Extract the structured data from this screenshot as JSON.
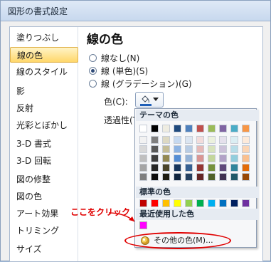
{
  "window": {
    "title": "図形の書式設定"
  },
  "sidebar": {
    "items": [
      {
        "label": "塗りつぶし"
      },
      {
        "label": "線の色"
      },
      {
        "label": "線のスタイル"
      },
      {
        "label": "影"
      },
      {
        "label": "反射"
      },
      {
        "label": "光彩とぼかし"
      },
      {
        "label": "3-D 書式"
      },
      {
        "label": "3-D 回転"
      },
      {
        "label": "図の修整"
      },
      {
        "label": "図の色"
      },
      {
        "label": "アート効果"
      },
      {
        "label": "トリミング"
      },
      {
        "label": "サイズ"
      }
    ],
    "selected_index": 1
  },
  "main": {
    "section_title": "線の色",
    "options": [
      {
        "label": "線なし(N)",
        "checked": false
      },
      {
        "label": "線 (単色)(S)",
        "checked": true
      },
      {
        "label": "線 (グラデーション)(G)",
        "checked": false
      }
    ],
    "color_label": "色(C):",
    "transparency_label": "透過性(T)"
  },
  "color_dropdown": {
    "theme_header": "テーマの色",
    "standard_header": "標準の色",
    "recent_header": "最近使用した色",
    "more_colors_label": "その他の色(M)...",
    "recent_color": "#ff00ff",
    "current_color": "#1f5fb8",
    "theme_top_row": [
      "#ffffff",
      "#000000",
      "#eeece1",
      "#1f497d",
      "#4f81bd",
      "#c0504d",
      "#9bbb59",
      "#8064a2",
      "#4bacc6",
      "#f79646"
    ],
    "theme_shades": [
      [
        "#f2f2f2",
        "#7f7f7f",
        "#ddd9c3",
        "#c6d9f0",
        "#dbe5f1",
        "#f2dcdb",
        "#ebf1dd",
        "#e5e0ec",
        "#dbeef3",
        "#fdeada"
      ],
      [
        "#d8d8d8",
        "#595959",
        "#c4bd97",
        "#8db3e2",
        "#b8cce4",
        "#e5b9b7",
        "#d7e3bc",
        "#ccc1d9",
        "#b7dde8",
        "#fbd5b5"
      ],
      [
        "#bfbfbf",
        "#3f3f3f",
        "#938953",
        "#548dd4",
        "#95b3d7",
        "#d99694",
        "#c3d69b",
        "#b2a2c7",
        "#92cddc",
        "#fac08f"
      ],
      [
        "#a5a5a5",
        "#262626",
        "#494429",
        "#17365d",
        "#366092",
        "#953734",
        "#76923c",
        "#5f497a",
        "#31859b",
        "#e36c09"
      ],
      [
        "#7f7f7f",
        "#0c0c0c",
        "#1d1b10",
        "#0f243e",
        "#244061",
        "#632423",
        "#4f6128",
        "#3f3151",
        "#205867",
        "#974806"
      ]
    ],
    "standard_colors": [
      "#c00000",
      "#ff0000",
      "#ffc000",
      "#ffff00",
      "#92d050",
      "#00b050",
      "#00b0f0",
      "#0070c0",
      "#002060",
      "#7030a0"
    ]
  },
  "annotation": {
    "callout_text": "ここをクリック",
    "accent_color": "#e00000"
  }
}
